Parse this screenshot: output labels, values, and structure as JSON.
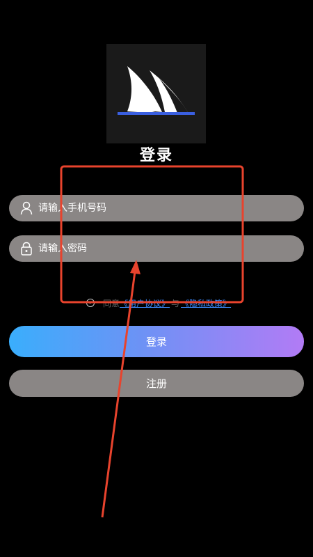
{
  "header": {
    "title": "登录"
  },
  "form": {
    "phone_placeholder": "请输入手机号码",
    "password_placeholder": "请输入密码"
  },
  "agreement": {
    "prefix": "同意",
    "user_agreement": "《用户协议》",
    "connector": "与",
    "privacy_policy": "《隐私政策》"
  },
  "buttons": {
    "login_label": "登录",
    "register_label": "注册"
  },
  "icons": {
    "logo": "sail-logo-icon",
    "user": "user-icon",
    "lock": "lock-icon",
    "radio": "radio-icon"
  },
  "colors": {
    "background": "#000000",
    "field_bg": "#8a8685",
    "login_gradient_start": "#3aaefc",
    "login_gradient_end": "#b27bf5",
    "annotation_red": "#e8432d",
    "link": "#3b8cff"
  }
}
